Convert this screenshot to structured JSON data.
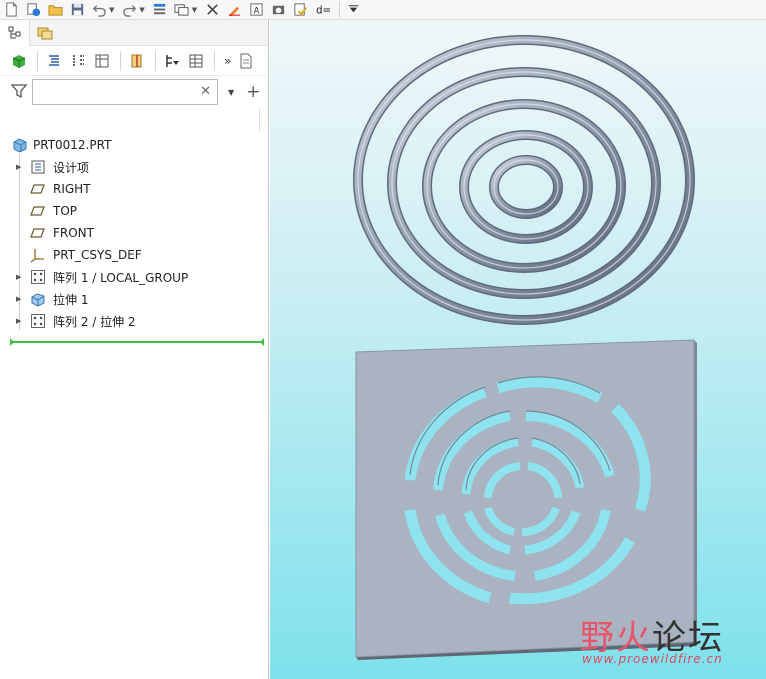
{
  "toolbar": {
    "icons": [
      "new-icon",
      "regenerate-icon",
      "open-icon",
      "save-icon",
      "undo-icon",
      "redo-icon",
      "regenerate-model-icon",
      "windows-icon",
      "close-window-icon",
      "sketch-icon",
      "annotation-icon",
      "screenshot-icon",
      "check-icon",
      "relations-icon",
      "customize-icon"
    ]
  },
  "tabs": [
    "model-tree-tab",
    "layer-tree-tab"
  ],
  "search": {
    "value": "",
    "placeholder": ""
  },
  "tree": {
    "root": "PRT0012.PRT",
    "items": [
      {
        "label": "设计项",
        "icon": "design-items-icon",
        "expandable": true
      },
      {
        "label": "RIGHT",
        "icon": "datum-plane-icon",
        "expandable": false
      },
      {
        "label": "TOP",
        "icon": "datum-plane-icon",
        "expandable": false
      },
      {
        "label": "FRONT",
        "icon": "datum-plane-icon",
        "expandable": false
      },
      {
        "label": "PRT_CSYS_DEF",
        "icon": "csys-icon",
        "expandable": false
      },
      {
        "label": "阵列 1 / LOCAL_GROUP",
        "icon": "pattern-icon",
        "expandable": true
      },
      {
        "label": "拉伸 1",
        "icon": "extrude-icon",
        "expandable": true
      },
      {
        "label": "阵列 2 / 拉伸 2",
        "icon": "pattern-icon",
        "expandable": true
      }
    ]
  },
  "watermark": {
    "cn_a": "野火",
    "cn_b": "论坛",
    "url": "www.proewildfire.cn"
  },
  "colors": {
    "accent_green": "#3dbf3d",
    "viewport_top": "#f1f7f9",
    "viewport_bottom": "#7ee1ec",
    "part_gray": "#a9b3c2"
  }
}
